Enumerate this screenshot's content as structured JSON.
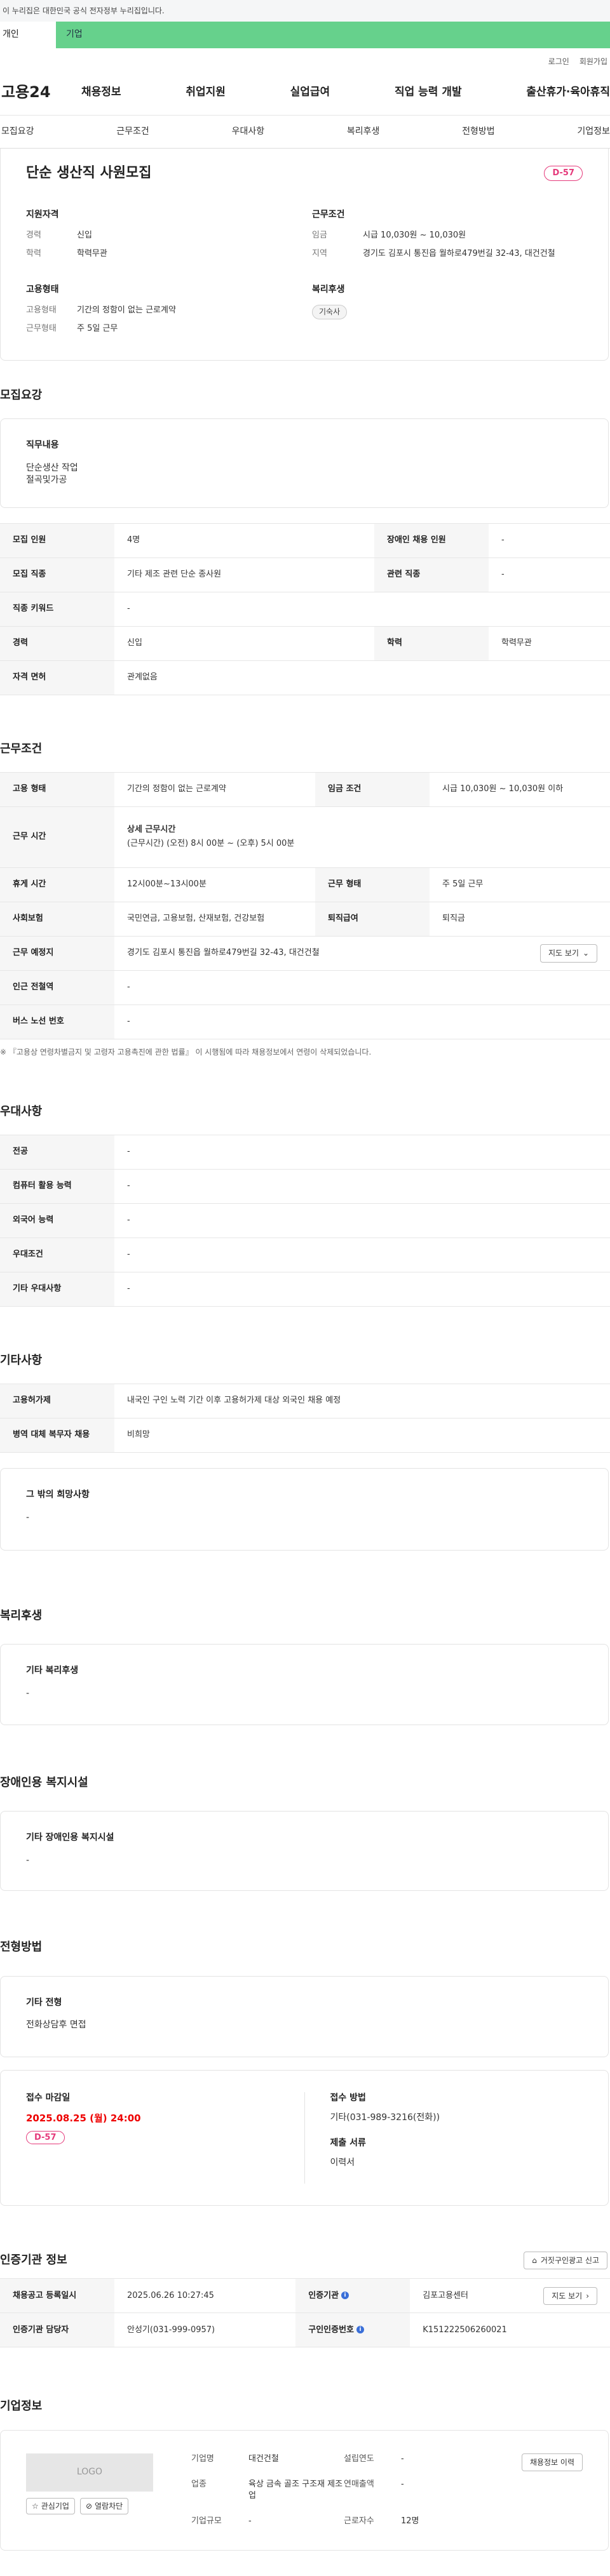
{
  "gov_banner": "이 누리집은 대한민국 공식 전자정부 누리집입니다.",
  "top_tabs": {
    "individual": "개인",
    "company": "기업"
  },
  "utility": {
    "login": "로그인",
    "signup": "회원가입"
  },
  "logo": "고용24",
  "gnb": [
    "채용정보",
    "취업지원",
    "실업급여",
    "직업 능력 개발",
    "출산휴가·육아휴직"
  ],
  "subnav": [
    "모집요강",
    "근무조건",
    "우대사항",
    "복리후생",
    "전형방법",
    "기업정보"
  ],
  "summary": {
    "title": "단순 생산직 사원모집",
    "dday": "D-57",
    "qual_title": "지원자격",
    "qual": [
      {
        "k": "경력",
        "v": "신입"
      },
      {
        "k": "학력",
        "v": "학력무관"
      }
    ],
    "cond_title": "근무조건",
    "cond": [
      {
        "k": "임금",
        "v": "시급 10,030원 ~ 10,030원"
      },
      {
        "k": "지역",
        "v": "경기도 김포시 통진읍 월하로479번길 32-43, 대건건철"
      }
    ],
    "emp_title": "고용형태",
    "emp": [
      {
        "k": "고용형태",
        "v": "기간의 정함이 없는 근로계약"
      },
      {
        "k": "근무형태",
        "v": "주 5일 근무"
      }
    ],
    "welfare_title": "복리후생",
    "welfare_chip": "기숙사"
  },
  "recruit": {
    "title": "모집요강",
    "duty_title": "직무내용",
    "duty_lines": [
      "단순생산 작업",
      "절곡및가공"
    ],
    "rows": [
      {
        "k1": "모집 인원",
        "v1": "4명",
        "k2": "장애인 채용 인원",
        "v2": "-"
      },
      {
        "k1": "모집 직종",
        "v1": "기타 제조 관련 단순 종사원",
        "k2": "관련 직종",
        "v2": "-"
      },
      {
        "k1": "직종 키워드",
        "v1": "-"
      },
      {
        "k1": "경력",
        "v1": "신입",
        "k2": "학력",
        "v2": "학력무관"
      },
      {
        "k1": "자격 면허",
        "v1": "관계없음"
      }
    ]
  },
  "work": {
    "title": "근무조건",
    "emp_type_k": "고용 형태",
    "emp_type_v": "기간의 정함이 없는 근로계약",
    "wage_k": "임금 조건",
    "wage_v": "시급 10,030원 ~ 10,030원 이하",
    "hours_k": "근무 시간",
    "hours_sub": "상세 근무시간",
    "hours_v": "(근무시간) (오전) 8시 00분 ~ (오후) 5시 00분",
    "break_k": "휴게 시간",
    "break_v": "12시00분~13시00분",
    "shape_k": "근무 형태",
    "shape_v": "주 5일 근무",
    "ins_k": "사회보험",
    "ins_v": "국민연금, 고용보험, 산재보험, 건강보험",
    "ret_k": "퇴직급여",
    "ret_v": "퇴직금",
    "place_k": "근무 예정지",
    "place_v": "경기도 김포시 통진읍 월하로479번길 32-43, 대건건철",
    "map_btn": "지도 보기",
    "station_k": "인근 전철역",
    "station_v": "-",
    "bus_k": "버스 노선 번호",
    "bus_v": "-",
    "note": "※ 『고용상 연령차별금지 및 고령자 고용촉진에 관한 법률』 이 시행됨에 따라 채용정보에서 연령이 삭제되었습니다."
  },
  "prefer": {
    "title": "우대사항",
    "rows": [
      {
        "k": "전공",
        "v": "-"
      },
      {
        "k": "컴퓨터 활용 능력",
        "v": "-"
      },
      {
        "k": "외국어 능력",
        "v": "-"
      },
      {
        "k": "우대조건",
        "v": "-"
      },
      {
        "k": "기타 우대사항",
        "v": "-"
      }
    ]
  },
  "etc": {
    "title": "기타사항",
    "rows": [
      {
        "k": "고용허가제",
        "v": "내국인 구인 노력 기간 이후 고용허가제 대상 외국인 채용 예정"
      },
      {
        "k": "병역 대체 복무자 채용",
        "v": "비희망"
      }
    ],
    "other_title": "그 밖의 희망사항",
    "other_v": "-"
  },
  "welfare": {
    "title": "복리후생",
    "box_title": "기타 복리후생",
    "box_v": "-"
  },
  "disabled": {
    "title": "장애인용 복지시설",
    "box_title": "기타 장애인용 복지시설",
    "box_v": "-"
  },
  "selection": {
    "title": "전형방법",
    "box_title": "기타 전형",
    "box_v": "전화상담후 면접",
    "deadline_k": "접수 마감일",
    "deadline_v": "2025.08.25 (월) 24:00",
    "dday": "D-57",
    "method_k": "접수 방법",
    "method_v": "기타(031-989-3216(전화))",
    "docs_k": "제출 서류",
    "docs_v": "이력서"
  },
  "agency": {
    "title": "인증기관 정보",
    "report_btn": "거짓구인광고 신고",
    "reg_k": "채용공고 등록일시",
    "reg_v": "2025.06.26 10:27:45",
    "org_k": "인증기관",
    "org_v": "김포고용센터",
    "map_btn": "지도 보기",
    "mgr_k": "인증기관 담당자",
    "mgr_v": "안성기(031-999-0957)",
    "id_k": "구인인증번호",
    "id_v": "K151222506260021"
  },
  "company": {
    "title": "기업정보",
    "logo": "LOGO",
    "fav_btn": "관심기업",
    "block_btn": "열람차단",
    "history_btn": "채용정보 이력",
    "name_k": "기업명",
    "name_v": "대건건철",
    "year_k": "설립연도",
    "year_v": "-",
    "industry_k": "업종",
    "industry_v": "육상 금속 골조 구조재 제조업",
    "sales_k": "연매출액",
    "sales_v": "-",
    "staff_k": "근로자수",
    "staff_v": "12명",
    "size_k": "기업규모",
    "size_v": "-"
  }
}
